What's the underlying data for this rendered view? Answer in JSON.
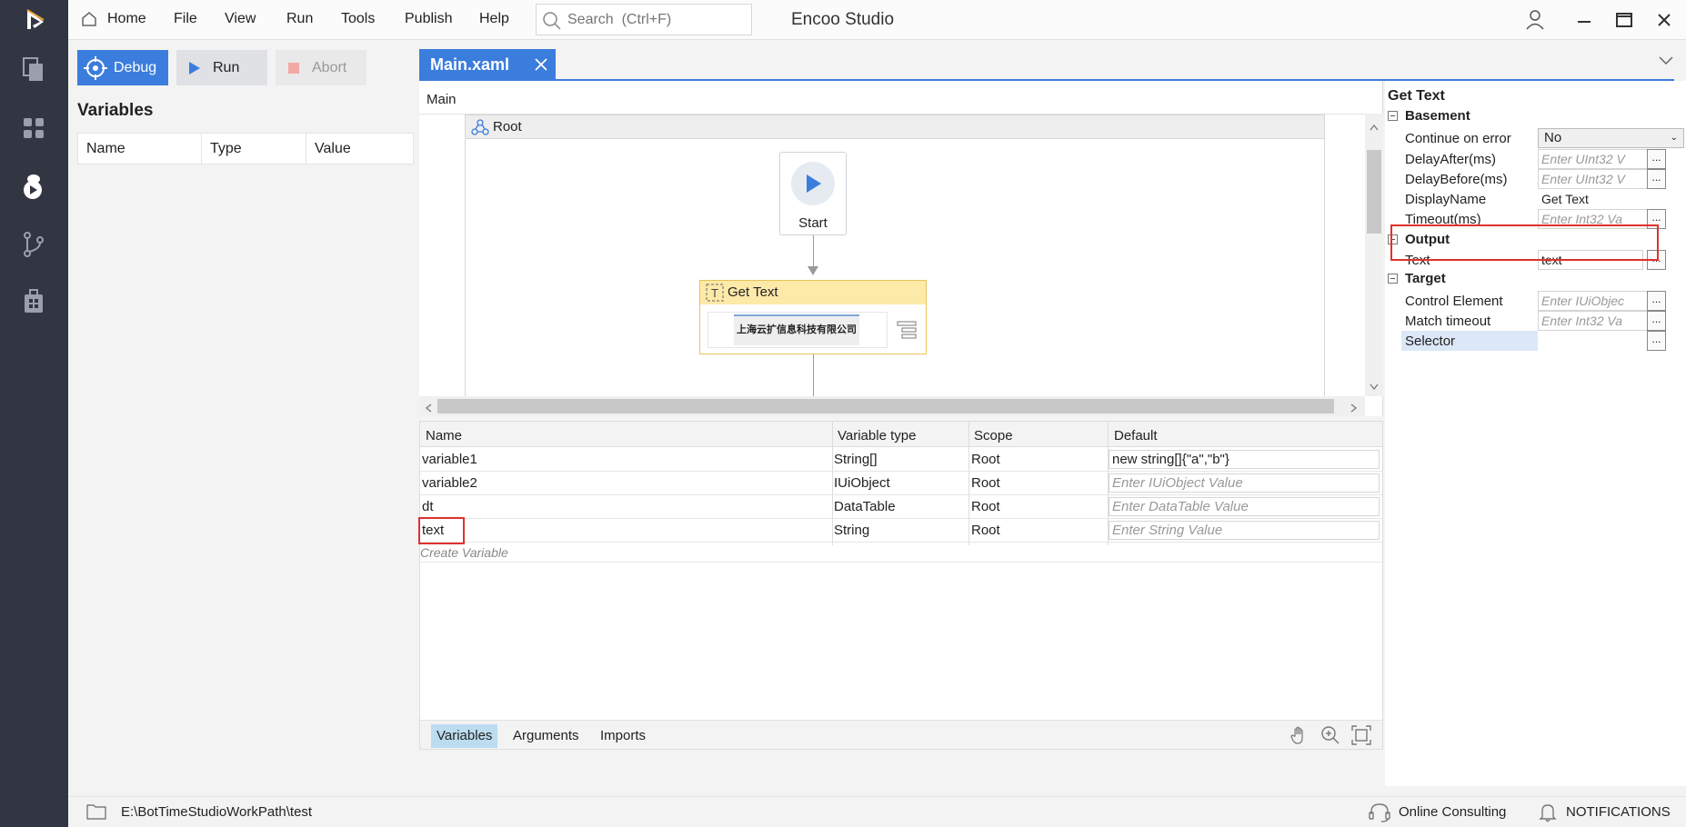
{
  "menubar": {
    "items": [
      "Home",
      "File",
      "View",
      "Run",
      "Tools",
      "Publish",
      "Help"
    ],
    "search_placeholder": "Search  (Ctrl+F)",
    "app_title": "Encoo Studio"
  },
  "toolbar": {
    "debug_label": "Debug",
    "run_label": "Run",
    "abort_label": "Abort"
  },
  "variables_panel": {
    "title": "Variables",
    "columns": [
      "Name",
      "Type",
      "Value"
    ]
  },
  "tabs": [
    {
      "label": "Main.xaml",
      "active": true
    }
  ],
  "designer": {
    "breadcrumb": "Main",
    "root_label": "Root",
    "start_label": "Start",
    "activity_label": "Get Text",
    "activity_preview_text": "上海云扩信息科技有限公司"
  },
  "variable_grid": {
    "columns": [
      "Name",
      "Variable type",
      "Scope",
      "Default"
    ],
    "rows": [
      {
        "name": "variable1",
        "type": "String[]",
        "scope": "Root",
        "default": "new string[]{\"a\",\"b\"}",
        "placeholder": false
      },
      {
        "name": "variable2",
        "type": "IUiObject",
        "scope": "Root",
        "default": "Enter IUiObject Value",
        "placeholder": true
      },
      {
        "name": "dt",
        "type": "DataTable",
        "scope": "Root",
        "default": "Enter DataTable Value",
        "placeholder": true
      },
      {
        "name": "text",
        "type": "String",
        "scope": "Root",
        "default": "Enter String Value",
        "placeholder": true
      }
    ],
    "create_label": "Create Variable",
    "footer_tabs": [
      "Variables",
      "Arguments",
      "Imports"
    ]
  },
  "properties": {
    "title": "Get Text",
    "basement": {
      "label": "Basement",
      "continue_on_error": {
        "name": "Continue on error",
        "value": "No"
      },
      "delay_after": {
        "name": "DelayAfter(ms)",
        "placeholder": "Enter UInt32 V"
      },
      "delay_before": {
        "name": "DelayBefore(ms)",
        "placeholder": "Enter UInt32 V"
      },
      "display_name": {
        "name": "DisplayName",
        "value": "Get Text"
      },
      "timeout": {
        "name": "Timeout(ms)",
        "placeholder": "Enter Int32 Va"
      }
    },
    "output": {
      "label": "Output",
      "text": {
        "name": "Text",
        "value": "text"
      }
    },
    "target": {
      "label": "Target",
      "control_element": {
        "name": "Control Element",
        "placeholder": "Enter IUiObjec"
      },
      "match_timeout": {
        "name": "Match timeout",
        "placeholder": "Enter Int32 Va"
      },
      "selector": {
        "name": "Selector",
        "value": ""
      }
    },
    "ellipsis": "..."
  },
  "statusbar": {
    "path": "E:\\BotTimeStudioWorkPath\\test",
    "online_consulting": "Online Consulting",
    "notifications": "NOTIFICATIONS"
  },
  "colors": {
    "accent": "#3b7ddd",
    "rail": "#323642",
    "highlight": "#e0312d",
    "activity_header": "#fde9a8"
  }
}
